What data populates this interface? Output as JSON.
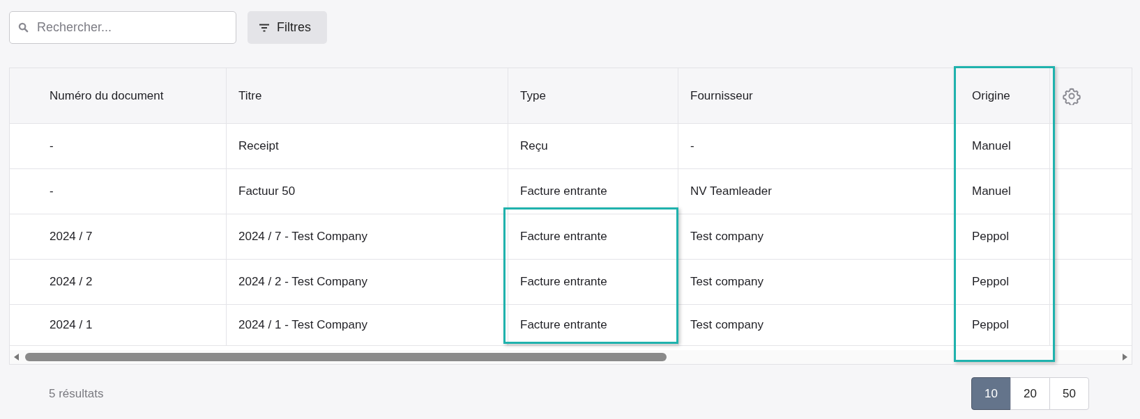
{
  "search": {
    "placeholder": "Rechercher..."
  },
  "filter_button": {
    "label": "Filtres"
  },
  "table": {
    "columns": [
      {
        "label": "Numéro du document",
        "highlighted": false
      },
      {
        "label": "Titre",
        "highlighted": false
      },
      {
        "label": "Type",
        "highlighted": false
      },
      {
        "label": "Fournisseur",
        "highlighted": false
      },
      {
        "label": "Origine",
        "highlighted": true
      }
    ],
    "rows": [
      {
        "number": "-",
        "title": "Receipt",
        "type": "Reçu",
        "supplier": "-",
        "origin": "Manuel",
        "type_highlighted": false
      },
      {
        "number": "-",
        "title": "Factuur 50",
        "type": "Facture entrante",
        "supplier": "NV Teamleader",
        "origin": "Manuel",
        "type_highlighted": false
      },
      {
        "number": "2024 / 7",
        "title": "2024 / 7 - Test Company",
        "type": "Facture entrante",
        "supplier": "Test company",
        "origin": "Peppol",
        "type_highlighted": true
      },
      {
        "number": "2024 / 2",
        "title": "2024 / 2 - Test Company",
        "type": "Facture entrante",
        "supplier": "Test company",
        "origin": "Peppol",
        "type_highlighted": true
      },
      {
        "number": "2024 / 1",
        "title": "2024 / 1 - Test Company",
        "type": "Facture entrante",
        "supplier": "Test company",
        "origin": "Peppol",
        "type_highlighted": true
      }
    ]
  },
  "footer": {
    "results": "5 résultats",
    "page_sizes": [
      {
        "label": "10",
        "selected": true
      },
      {
        "label": "20",
        "selected": false
      },
      {
        "label": "50",
        "selected": false
      }
    ]
  }
}
